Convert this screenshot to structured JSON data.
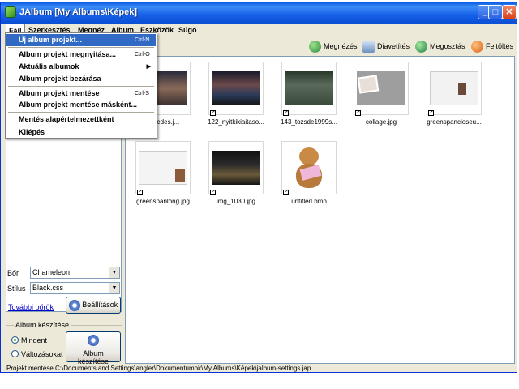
{
  "window": {
    "title": "JAlbum [My Albums\\Képek]"
  },
  "menubar": [
    "Fájl",
    "Szerkesztés",
    "Megnéz",
    "Album",
    "Eszközök",
    "Súgó"
  ],
  "file_menu": [
    {
      "label": "Új album projekt...",
      "shortcut": "Ctrl-N"
    },
    {
      "label": "Album projekt megnyitása...",
      "shortcut": "Ctrl-O"
    },
    {
      "label": "Aktuális albumok",
      "shortcut": ""
    },
    {
      "label": "Album projekt bezárása",
      "shortcut": ""
    },
    {
      "label": "Album projekt mentése",
      "shortcut": "Ctrl-S"
    },
    {
      "label": "Album projekt mentése másként...",
      "shortcut": ""
    },
    {
      "label": "Mentés alapértelmezettként",
      "shortcut": ""
    },
    {
      "label": "Kilépés",
      "shortcut": ""
    }
  ],
  "toolbar": {
    "view": "Megnézés",
    "slideshow": "Diavetítés",
    "share": "Megosztás",
    "upload": "Feltöltés"
  },
  "left": {
    "skin_label": "Bőr",
    "skin_value": "Chameleon",
    "style_label": "Stílus",
    "style_value": "Black.css",
    "more_skins": "További bőrök",
    "settings_button": "Beállítások",
    "group_title": "Album készítése",
    "radio_all": "Mindent",
    "radio_changes": "Változásokat",
    "make_button": "Album készítése"
  },
  "thumbnails": [
    {
      "name": "eskedes.j..."
    },
    {
      "name": "122_nyitkikiaitaso..."
    },
    {
      "name": "143_tozsde1999s..."
    },
    {
      "name": "collage.jpg"
    },
    {
      "name": "greenspancloseu..."
    },
    {
      "name": "greenspanlong.jpg"
    },
    {
      "name": "img_1030.jpg"
    },
    {
      "name": "untitled.bmp"
    }
  ],
  "status": "Projekt mentése C:\\Documents and Settings\\angler\\Dokumentumok\\My Albums\\Képek\\jalbum-settings.jap",
  "colors": {
    "titlebar": "#1660e8",
    "menu_highlight": "#316ac5",
    "close": "#d9431c"
  }
}
